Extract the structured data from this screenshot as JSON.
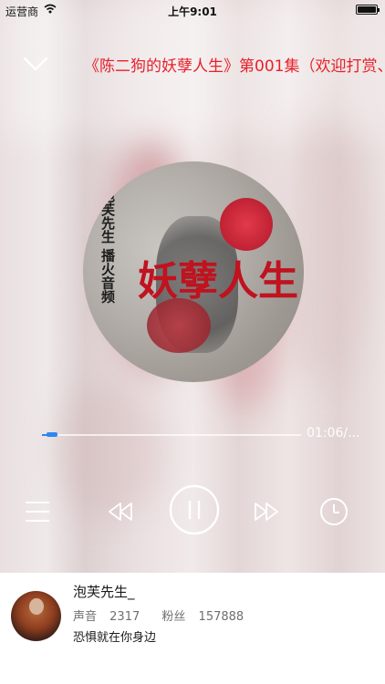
{
  "status_bar": {
    "carrier": "运营商",
    "time": "上午9:01"
  },
  "player": {
    "title": "《陈二狗的妖孽人生》第001集（欢迎打赏、",
    "cover_texts": {
      "big": "妖孽人生",
      "side": "泡芙先生 播火音频"
    },
    "progress": 0.04,
    "time_display": "01:06/..."
  },
  "colors": {
    "title": "#e8202a",
    "progress": "#2f86f0"
  },
  "author": {
    "name": "泡芙先生_",
    "voice_label": "声音",
    "voice_count": "2317",
    "fans_label": "粉丝",
    "fans_count": "157888",
    "bio": "恐惧就在你身边"
  },
  "icons": {
    "collapse": "chevron-down-icon",
    "menu": "menu-icon",
    "prev": "rewind-icon",
    "play": "pause-icon",
    "next": "fast-forward-icon",
    "timer": "clock-icon"
  }
}
